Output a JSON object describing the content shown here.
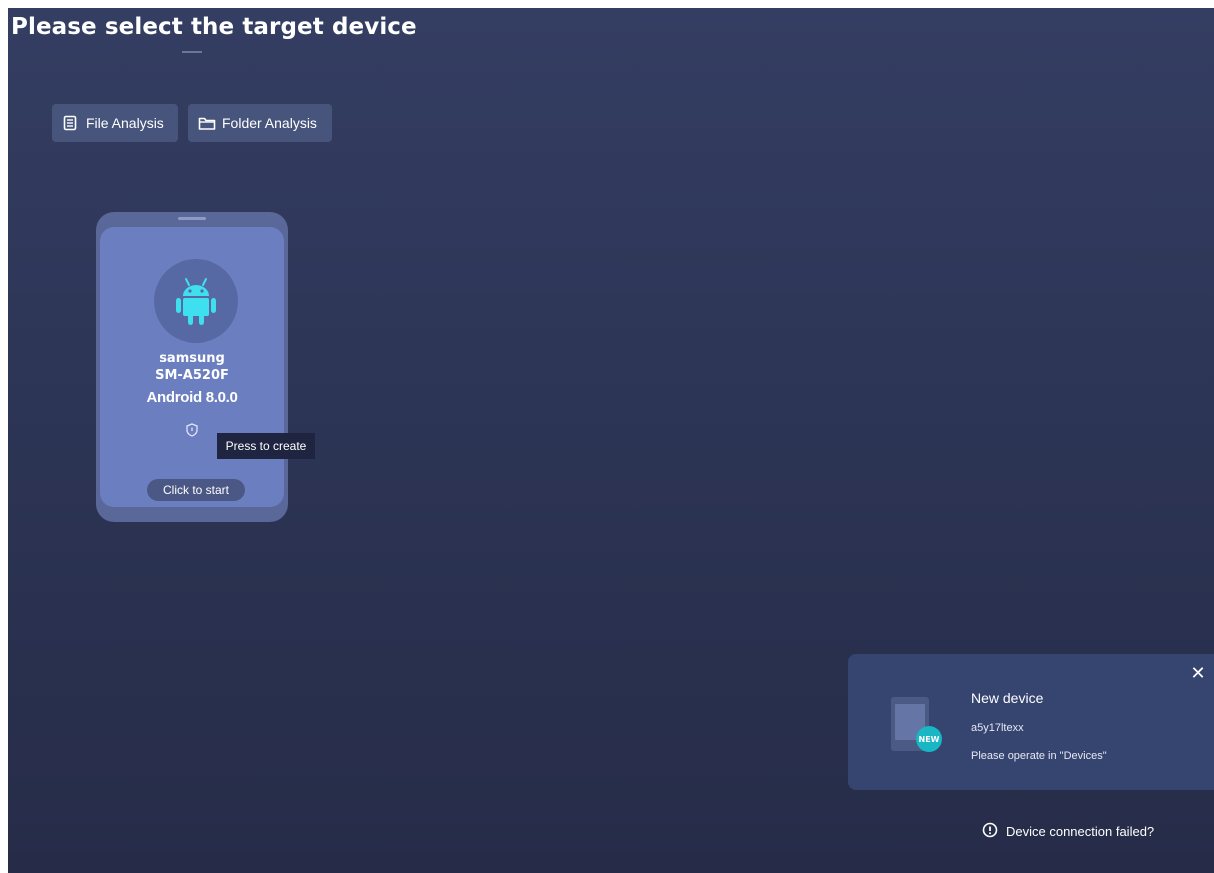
{
  "page": {
    "title": "Please select the target device"
  },
  "toolbar": {
    "file_analysis_label": "File Analysis",
    "file_analysis_icon": "document-icon",
    "folder_analysis_label": "Folder Analysis",
    "folder_analysis_icon": "folder-icon"
  },
  "device": {
    "icon": "android-icon",
    "brand": "samsung",
    "model": "SM-A520F",
    "os": "Android 8.0.0",
    "shield_icon": "shield-icon",
    "start_label": "Click to start",
    "tooltip": "Press to create"
  },
  "notification": {
    "title": "New device",
    "device_id": "a5y17ltexx",
    "message": "Please operate in \"Devices\"",
    "badge": "NEW",
    "close_icon": "close-icon"
  },
  "footer": {
    "help_label": "Device connection failed?",
    "help_icon": "alert-circle-icon"
  },
  "colors": {
    "background": "#2d3556",
    "button": "#47557d",
    "card": "#6b7fc0",
    "android_green": "#3ee0f0",
    "badge": "#19b7c4"
  }
}
